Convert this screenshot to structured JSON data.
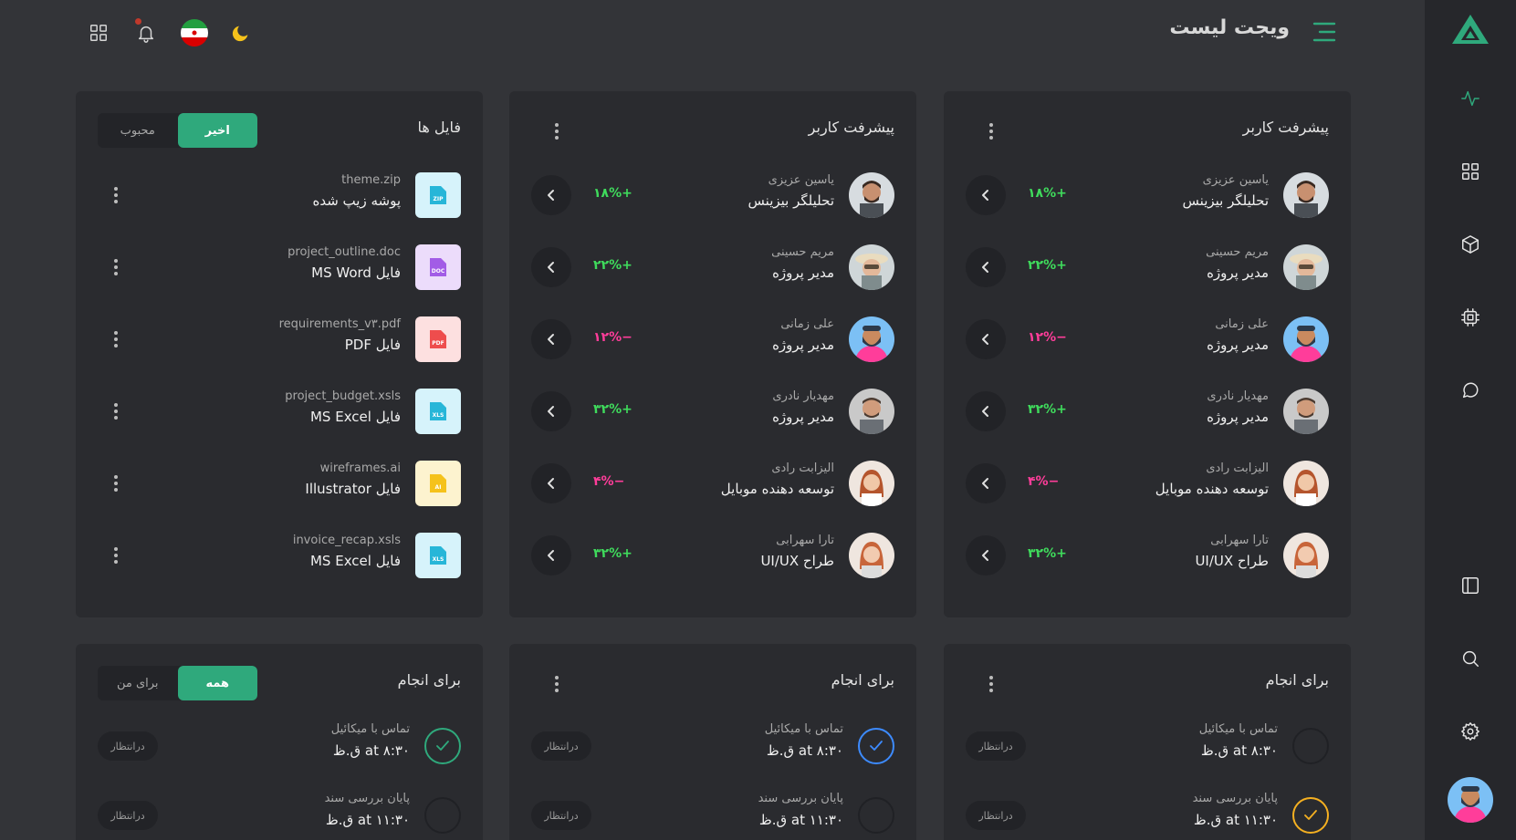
{
  "header": {
    "title": "ویجت لیست",
    "icons": [
      "menu-icon",
      "moon-icon",
      "flag-iran-icon",
      "bell-icon",
      "grid-icon"
    ]
  },
  "sidebar": {
    "icons": [
      "logo-icon",
      "activity-icon",
      "grid-icon",
      "cube-icon",
      "chip-icon",
      "chat-icon",
      "sidebar-icon",
      "search-icon",
      "gear-icon"
    ]
  },
  "colors": {
    "accent": "#2fa97c",
    "positive": "#3fdb5c",
    "negative": "#ff3d9a",
    "check_green": "#2fa97c",
    "check_blue": "#3d8bff",
    "check_yellow": "#f5b021"
  },
  "user_progress_1": {
    "title": "پیشرفت کاربر",
    "users": [
      {
        "name": "یاسین عزیزی",
        "role": "تحلیلگر بیزینس",
        "pct": "۱۸%+",
        "trend": "up"
      },
      {
        "name": "مریم حسینی",
        "role": "مدیر پروژه",
        "pct": "۲۲%+",
        "trend": "up"
      },
      {
        "name": "علی زمانی",
        "role": "مدیر پروژه",
        "pct": "۱۲%−",
        "trend": "down"
      },
      {
        "name": "مهدیار نادری",
        "role": "مدیر پروژه",
        "pct": "۳۲%+",
        "trend": "up"
      },
      {
        "name": "الیزابت رادی",
        "role": "توسعه دهنده موبایل",
        "pct": "۴%−",
        "trend": "down"
      },
      {
        "name": "تارا سهرابی",
        "role": "طراح UI/UX",
        "pct": "۳۲%+",
        "trend": "up"
      }
    ]
  },
  "user_progress_2": {
    "title": "پیشرفت کاربر",
    "users": [
      {
        "name": "یاسین عزیزی",
        "role": "تحلیلگر بیزینس",
        "pct": "۱۸%+",
        "trend": "up"
      },
      {
        "name": "مریم حسینی",
        "role": "مدیر پروژه",
        "pct": "۲۲%+",
        "trend": "up"
      },
      {
        "name": "علی زمانی",
        "role": "مدیر پروژه",
        "pct": "۱۲%−",
        "trend": "down"
      },
      {
        "name": "مهدیار نادری",
        "role": "مدیر پروژه",
        "pct": "۳۲%+",
        "trend": "up"
      },
      {
        "name": "الیزابت رادی",
        "role": "توسعه دهنده موبایل",
        "pct": "۴%−",
        "trend": "down"
      },
      {
        "name": "تارا سهرابی",
        "role": "طراح UI/UX",
        "pct": "۳۲%+",
        "trend": "up"
      }
    ]
  },
  "files": {
    "title": "فایل ها",
    "tab_recent": "اخیر",
    "tab_popular": "محبوب",
    "items": [
      {
        "name": "theme.zip",
        "type": "پوشه زیپ شده",
        "icon": "ZIP",
        "bg": "#d6f3fb",
        "fg": "#27b6d8"
      },
      {
        "name": "project_outline.doc",
        "type": "فایل MS Word",
        "icon": "DOC",
        "bg": "#ecdcfb",
        "fg": "#a25ce6"
      },
      {
        "name": "requirements_v۳.pdf",
        "type": "فایل PDF",
        "icon": "PDF",
        "bg": "#fde0e0",
        "fg": "#ee4d4d"
      },
      {
        "name": "project_budget.xsls",
        "type": "فایل MS Excel",
        "icon": "XLS",
        "bg": "#d6f3fb",
        "fg": "#27b6d8"
      },
      {
        "name": "wireframes.ai",
        "type": "فایل Illustrator",
        "icon": "AI",
        "bg": "#fdf3cf",
        "fg": "#f5c21b"
      },
      {
        "name": "invoice_recap.xsls",
        "type": "فایل MS Excel",
        "icon": "XLS",
        "bg": "#d6f3fb",
        "fg": "#27b6d8"
      }
    ]
  },
  "todo_1": {
    "title": "برای انجام",
    "items": [
      {
        "name": "تماس با میکائیل",
        "time": "at ۸:۳۰ ق.ظ",
        "status": "درانتظار",
        "check": "none"
      },
      {
        "name": "پایان بررسی سند",
        "time": "at ۱۱:۳۰ ق.ظ",
        "status": "درانتظار",
        "check": "yellow"
      }
    ]
  },
  "todo_2": {
    "title": "برای انجام",
    "items": [
      {
        "name": "تماس با میکائیل",
        "time": "at ۸:۳۰ ق.ظ",
        "status": "درانتظار",
        "check": "blue"
      },
      {
        "name": "پایان بررسی سند",
        "time": "at ۱۱:۳۰ ق.ظ",
        "status": "درانتظار",
        "check": "none"
      }
    ]
  },
  "todo_3": {
    "title": "برای انجام",
    "tab_all": "همه",
    "tab_mine": "برای من",
    "items": [
      {
        "name": "تماس با میکائیل",
        "time": "at ۸:۳۰ ق.ظ",
        "status": "درانتظار",
        "check": "green"
      },
      {
        "name": "پایان بررسی سند",
        "time": "at ۱۱:۳۰ ق.ظ",
        "status": "درانتظار",
        "check": "none"
      }
    ]
  }
}
